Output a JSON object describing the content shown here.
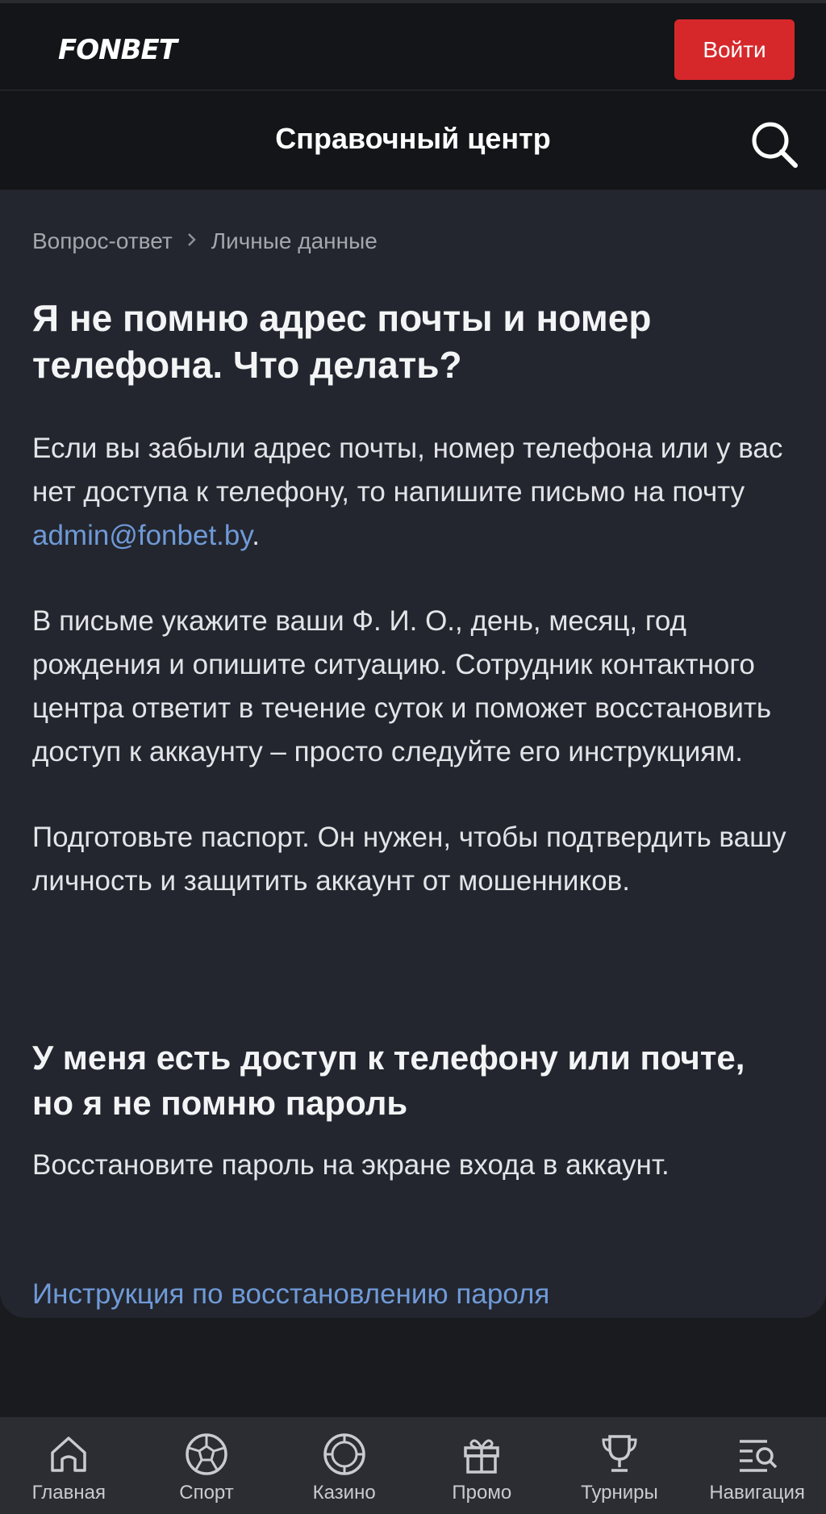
{
  "header": {
    "logo": "FONBET",
    "login_label": "Войти"
  },
  "titlebar": {
    "title": "Справочный центр",
    "search_icon": "search-icon"
  },
  "breadcrumb": {
    "items": [
      "Вопрос-ответ",
      "Личные данные"
    ],
    "separator_icon": "chevron-right-icon"
  },
  "article": {
    "title": "Я не помню адрес почты и номер телефона. Что делать?",
    "p1_text": "Если вы забыли адрес почты, номер телефона или у вас нет доступа к телефону, то напишите письмо на почту ",
    "p1_email": "admin@fonbet.by",
    "p1_end": ".",
    "p2": "В письме укажите ваши Ф. И. О., день, месяц, год рождения и опишите ситуацию. Сотрудник контактного центра ответит в течение суток и поможет восстановить доступ к аккаунту – просто следуйте его инструкциям.",
    "p3": "Подготовьте паспорт. Он нужен, чтобы подтвердить вашу личность и защитить аккаунт от мошенников.",
    "subtitle": "У меня есть доступ к телефону или почте, но я не помню пароль",
    "p4": "Восстановите пароль на экране входа в аккаунт.",
    "link": "Инструкция по восстановлению пароля"
  },
  "bottom_nav": {
    "items": [
      {
        "label": "Главная",
        "icon": "home-icon"
      },
      {
        "label": "Спорт",
        "icon": "soccer-ball-icon"
      },
      {
        "label": "Казино",
        "icon": "casino-chip-icon"
      },
      {
        "label": "Промо",
        "icon": "gift-icon"
      },
      {
        "label": "Турниры",
        "icon": "trophy-icon"
      },
      {
        "label": "Навигация",
        "icon": "navigation-menu-icon"
      }
    ]
  },
  "colors": {
    "brand_red": "#d6282b",
    "link_blue": "#6f9ad8",
    "background": "#1a1b1f",
    "card": "#23262e"
  }
}
